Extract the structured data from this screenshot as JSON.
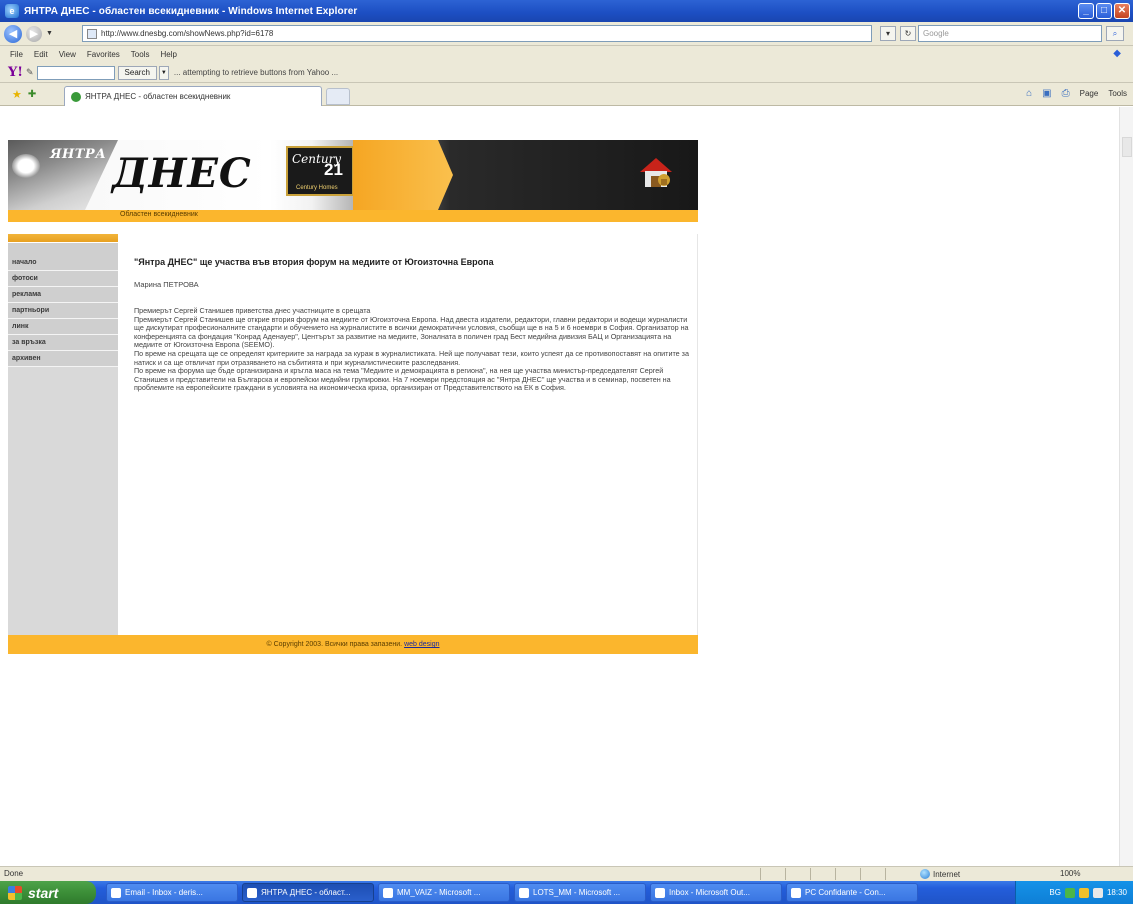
{
  "window": {
    "title": "ЯНТРА ДНЕС - областен всекидневник - Windows Internet Explorer",
    "minimize": "_",
    "maximize": "□",
    "close": "✕"
  },
  "address": {
    "url": "http://www.dnesbg.com/showNews.php?id=6178",
    "search_placeholder": "Google"
  },
  "menu": [
    "File",
    "Edit",
    "View",
    "Favorites",
    "Tools",
    "Help"
  ],
  "yahoo": {
    "logo": "Y!",
    "search_label": "Search",
    "status": "... attempting to retrieve buttons from Yahoo ..."
  },
  "tab": {
    "label": "ЯНТРА ДНЕС - областен всекидневник"
  },
  "commands": {
    "page": "Page",
    "tools": "Tools"
  },
  "site": {
    "brand_small": "ЯНТРА",
    "brand_big": "ДНЕС",
    "sponsor_name": "Century",
    "sponsor_number": "21",
    "sponsor_sub": "Century Homes",
    "subtitle": "Областен всекидневник",
    "nav": [
      "начало",
      "фотоси",
      "реклама",
      "партньори",
      "линк",
      "за връзка",
      "архивен"
    ],
    "article": {
      "title": "\"Янтра ДНЕС\" ще участва във втория форум на медиите от Югоизточна Европа",
      "author": "Марина ПЕТРОВА",
      "paragraphs": [
        "Премиерът Сергей Станишев приветства днес участниците в срещата",
        "Премиерът Сергей Станишев ще открие втория форум на медиите от Югоизточна Европа. Над двеста издатели, редактори, главни редактори и водещи журналисти ще дискутират професионалните стандарти и обучението на журналистите в всички демократични условия, съобщи ще в на 5 и 6 ноември в София. Организатор на конференцията са фондация \"Конрад Аденауер\", Центърът за развитие на медиите, Зоналната в поличен град Бест медийна дивизия БАЦ и Организацията на медиите от Югоизточна Европа (SEEMO).",
        "По време на срещата ще се определят критериите за награда за кураж в журналистиката. Ней ще получават тези, които успеят да се противопоставят на опитите за натиск и са ще отвличат при отразяването на събитията и при журналистическите разследвания.",
        "По време на форума ще бъде организирана и кръгла маса на тема \"Медиите и демокрацията в региона\", на нея ще участва министър-председателят Сергей Станишев и представители на Българска и европейски медийни групировки. На 7 ноември предстоящия ас \"Янтра ДНЕС\" ще участва и в семинар, посветен на проблемите на европейските граждани в условията на икономическа криза, организиран от Представителството на ЕК в София."
      ]
    },
    "footer_text": "© Copyright 2003. Всички права запазени. ",
    "footer_link": "web design"
  },
  "status": {
    "text": "Done",
    "zone": "Internet",
    "zoom": "100%"
  },
  "taskbar": {
    "start": "start",
    "tasks": [
      "Email - Inbox - deris...",
      "ЯНТРА ДНЕС - област...",
      "MM_VAIZ - Microsoft ...",
      "LOTS_MM - Microsoft ...",
      "Inbox - Microsoft Out...",
      "PC Confidante - Con..."
    ],
    "lang": "BG",
    "clock": "18:30"
  }
}
